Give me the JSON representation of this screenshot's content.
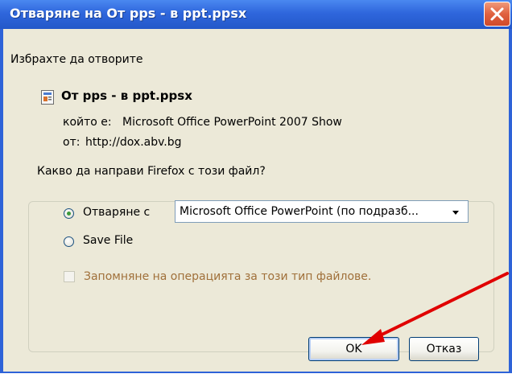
{
  "dialog": {
    "title": "Отваряне на От pps - в ppt.ppsx",
    "intro": "Избрахте да отворите",
    "file_name": "От pps - в ppt.ppsx",
    "type_label": "който е:",
    "type_value": "Microsoft Office PowerPoint 2007 Show",
    "from_label": "от:",
    "from_value": "http://dox.abv.bg"
  },
  "action_group": {
    "legend": "Какво да направи Firefox с този файл?",
    "open_with_label": "Отваряне с",
    "open_with_value": "Microsoft Office PowerPoint (по подразб...",
    "save_file_label": "Save File",
    "remember_label": "Запомняне на операцията за този тип файлове.",
    "selected_option": "open_with",
    "remember_checked": false
  },
  "buttons": {
    "ok": "OK",
    "cancel": "Отказ"
  },
  "annotation": {
    "arrow_color": "#e00000"
  },
  "icons": {
    "close": "close-icon",
    "file": "powerpoint-file-icon",
    "dropdown": "chevron-down-icon"
  }
}
